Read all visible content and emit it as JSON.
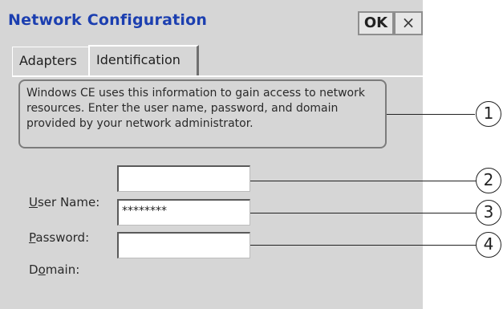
{
  "window": {
    "title": "Network Configuration",
    "ok_label": "OK",
    "close_glyph": "×"
  },
  "tabs": [
    {
      "label": "Adapters",
      "active": false
    },
    {
      "label": "Identification",
      "active": true
    }
  ],
  "info_text": "Windows CE uses this information to gain access to network resources. Enter the user name, password, and domain provided by your network administrator.",
  "fields": {
    "user_name": {
      "label_key": "U",
      "label_rest": "ser Name:",
      "value": ""
    },
    "password": {
      "label_key": "P",
      "label_rest": "assword:",
      "value": "********"
    },
    "domain": {
      "label_pre": "D",
      "label_key": "o",
      "label_rest": "main:",
      "value": ""
    }
  },
  "callouts": [
    "1",
    "2",
    "3",
    "4"
  ],
  "colors": {
    "title": "#1c3fb0",
    "window_bg": "#d6d6d6"
  }
}
